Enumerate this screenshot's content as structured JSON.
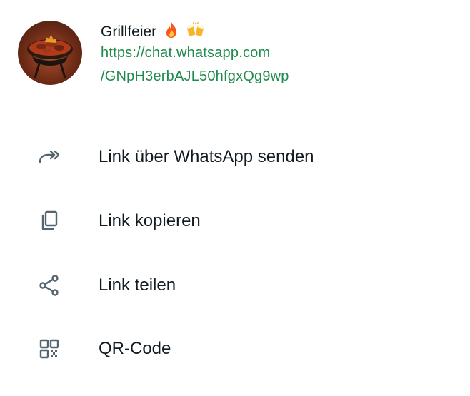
{
  "group": {
    "name": "Grillfeier",
    "emoji": [
      "fire",
      "beer-mugs"
    ],
    "link_line1": "https://chat.whatsapp.com",
    "link_line2": "/GNpH3erbAJL50hfgxQg9wp"
  },
  "menu": {
    "send_label": "Link über WhatsApp senden",
    "copy_label": "Link kopieren",
    "share_label": "Link teilen",
    "qr_label": "QR-Code"
  },
  "colors": {
    "link": "#1f8a4c",
    "text": "#111b21",
    "icon": "#54656f"
  }
}
